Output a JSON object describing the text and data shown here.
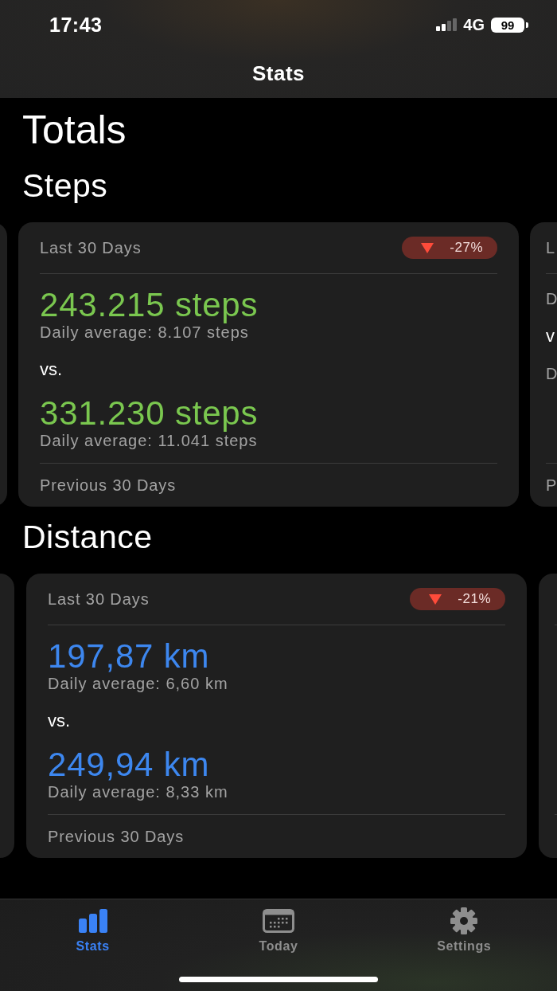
{
  "status_bar": {
    "time": "17:43",
    "network": "4G",
    "battery": "99"
  },
  "nav": {
    "title": "Stats"
  },
  "page_title": "Totals",
  "sections": [
    {
      "title": "Steps",
      "color": "#7ac74f",
      "cards": [
        {
          "kind": "peek"
        },
        {
          "kind": "full",
          "label": "Last 30 Days",
          "change": "-27%",
          "current": "243.215 steps",
          "current_avg": "Daily average: 8.107 steps",
          "vs": "vs.",
          "previous": "331.230 steps",
          "previous_avg": "Daily average: 11.041 steps",
          "footer": "Previous 30 Days"
        },
        {
          "kind": "peek",
          "label": "L",
          "current_avg": "D",
          "vs": "v",
          "previous_avg": "D",
          "footer": "P"
        }
      ]
    },
    {
      "title": "Distance",
      "color": "#3d87ef",
      "cards": [
        {
          "kind": "peek"
        },
        {
          "kind": "full",
          "label": "Last 30 Days",
          "change": "-21%",
          "current": "197,87 km",
          "current_avg": "Daily average: 6,60 km",
          "vs": "vs.",
          "previous": "249,94 km",
          "previous_avg": "Daily average: 8,33 km",
          "footer": "Previous 30 Days"
        },
        {
          "kind": "peek"
        }
      ]
    }
  ],
  "tabs": [
    {
      "label": "Stats",
      "selected": true
    },
    {
      "label": "Today",
      "selected": false
    },
    {
      "label": "Settings",
      "selected": false
    }
  ]
}
